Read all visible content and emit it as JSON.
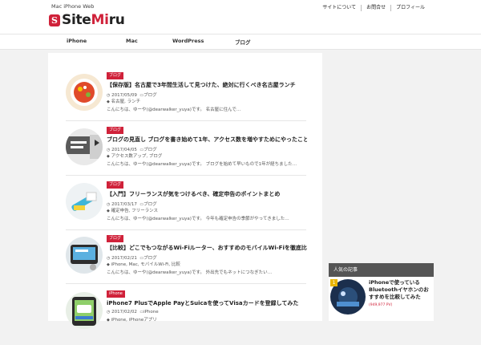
{
  "header": {
    "tagline": "Mac iPhone Web",
    "logo_mark": "S",
    "logo_text_a": "Site",
    "logo_text_b": "Mi",
    "logo_text_c": "ru",
    "top_links": [
      "サイトについて",
      "お問合せ",
      "プロフィール"
    ]
  },
  "nav": {
    "items": [
      "iPhone",
      "Mac",
      "WordPress",
      "ブログ"
    ]
  },
  "posts": [
    {
      "category": "ブログ",
      "title": "【保存版】名古屋で3年間生活して見つけた、絶対に行くべき名古屋ランチ",
      "date": "2017/05/09",
      "author": "ブログ",
      "tags": "名古屋, ランチ",
      "excerpt": "こんにちは、ゆーや(@dearwalker_yuya)です。 名古屋に住んで…"
    },
    {
      "category": "ブログ",
      "title": "ブログの見直し ブログを書き始めて1年、アクセス数を増やすためにやったこと",
      "date": "2017/04/05",
      "author": "ブログ",
      "tags": "アクセス数アップ, ブログ",
      "excerpt": "こんにちは、ゆーや(@dearwalker_yuya)です。 ブログを始めて早いもので1年が経ちました…"
    },
    {
      "category": "ブログ",
      "title": "【入門】フリーランスが気をつけるべき、確定申告のポイントまとめ",
      "date": "2017/03/17",
      "author": "ブログ",
      "tags": "確定申告, フリーランス",
      "excerpt": "こんにちは、ゆーや(@dearwalker_yuya)です。 今年も確定申告の季節がやってきました…"
    },
    {
      "category": "ブログ",
      "title": "【比較】どこでもつながるWi-Fiルーター、おすすめのモバイルWi-Fiを徹底比較してみた!!",
      "date": "2017/02/21",
      "author": "ブログ",
      "tags": "iPhone, Mac, モバイルWi-Fi, 比較",
      "excerpt": "こんにちは、ゆーや(@dearwalker_yuya)です。 外出先でもネットにつなぎたい…"
    },
    {
      "category": "iPhone",
      "title": "iPhone7 PlusでApple PayとSuicaを使ってVisaカードを登録してみた",
      "date": "2017/02/02",
      "author": "iPhone",
      "tags": "iPhone, iPhoneアプリ",
      "excerpt": ""
    }
  ],
  "sidebar": {
    "heading": "人気の記事",
    "item": {
      "rank": "1",
      "title": "iPhoneで使っているBluetoothイヤホンのおすすめを比較してみた",
      "views": "(949,977 PV)"
    }
  },
  "colors": {
    "accent": "#d0223a",
    "sidebar_head": "#555555",
    "rank_badge": "#e8b400"
  },
  "icons": {
    "date": "clock-icon",
    "author": "folder-icon",
    "tags": "tag-icon"
  }
}
